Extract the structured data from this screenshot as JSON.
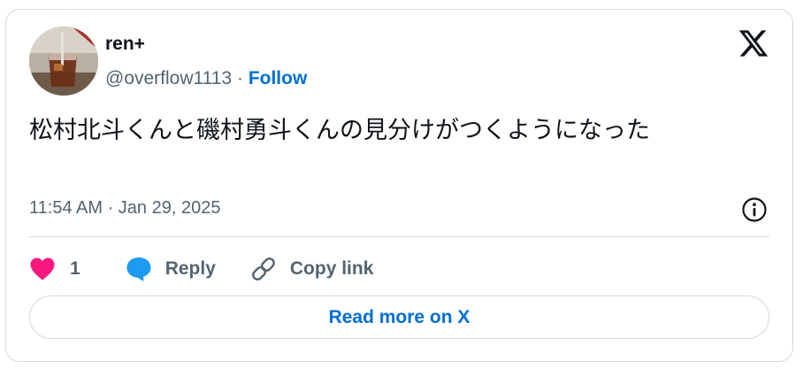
{
  "author": {
    "display_name": "ren+",
    "handle": "@overflow1113",
    "separator": "·",
    "follow_label": "Follow"
  },
  "tweet": {
    "text": "松村北斗くんと磯村勇斗くんの見分けがつくようになった",
    "timestamp": "11:54 AM · Jan 29, 2025"
  },
  "actions": {
    "like_count": "1",
    "reply_label": "Reply",
    "copy_link_label": "Copy link"
  },
  "read_more_label": "Read more on X",
  "icons": {
    "brand": "x-logo-icon",
    "info": "info-icon",
    "like": "heart-icon",
    "reply": "speech-bubble-icon",
    "copy_link": "link-icon"
  },
  "colors": {
    "accent": "#006fd6",
    "like": "#f91880",
    "reply": "#1d9bf0",
    "muted_text": "#536471",
    "border": "#cfd9de"
  }
}
